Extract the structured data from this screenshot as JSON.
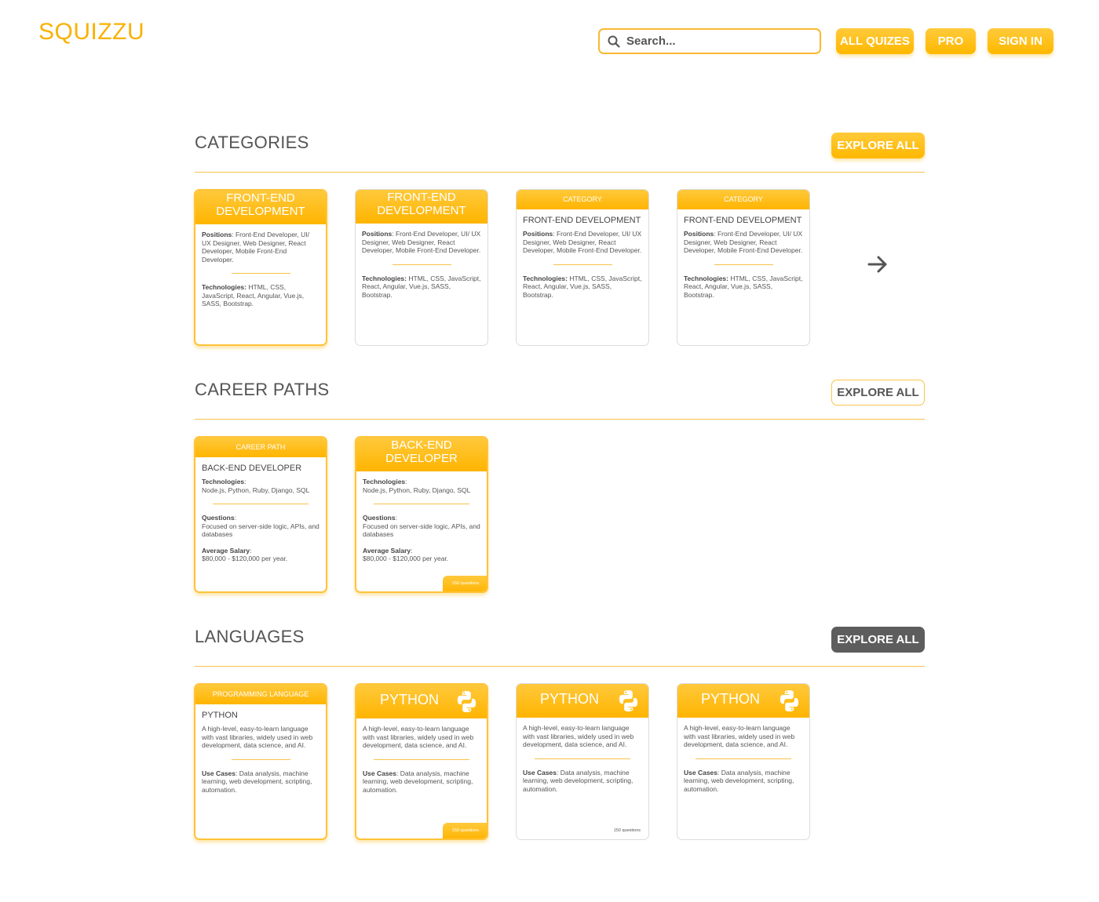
{
  "header": {
    "logo": "SQUIZZU",
    "search_placeholder": "Search...",
    "nav": [
      "ALL QUIZES",
      "PRO",
      "SIGN IN"
    ]
  },
  "sections": {
    "categories": {
      "title": "CATEGORIES",
      "explore": "EXPLORE ALL",
      "cards": [
        {
          "header": "FRONT-END DEVELOPMENT",
          "label1": "Positions",
          "text1": ": Front-End Developer, UI/ UX Designer, Web Designer, React Developer, Mobile Front-End Developer.",
          "label2": "Technologies:",
          "text2": " HTML, CSS, JavaScript, React, Angular, Vue.js, SASS, Bootstrap."
        },
        {
          "header": "FRONT-END DEVELOPMENT",
          "label1": "Positions",
          "text1": ": Front-End Developer, UI/ UX Designer, Web Designer, React Developer, Mobile Front-End Developer.",
          "label2": "Technologies:",
          "text2": " HTML, CSS, JavaScript, React, Angular, Vue.js, SASS, Bootstrap."
        },
        {
          "header": "CATEGORY",
          "title": "FRONT-END DEVELOPMENT",
          "label1": "Positions",
          "text1": ": Front-End Developer, UI/ UX Designer, Web Designer, React Developer, Mobile Front-End Developer.",
          "label2": "Technologies:",
          "text2": " HTML, CSS, JavaScript, React, Angular, Vue.js, SASS, Bootstrap."
        },
        {
          "header": "CATEGORY",
          "title": "FRONT-END DEVELOPMENT",
          "label1": "Positions",
          "text1": ": Front-End Developer, UI/ UX Designer, Web Designer, React Developer, Mobile Front-End Developer.",
          "label2": "Technologies:",
          "text2": " HTML, CSS, JavaScript, React, Angular, Vue.js, SASS, Bootstrap."
        }
      ]
    },
    "career_paths": {
      "title": "CAREER PATHS",
      "explore": "EXPLORE ALL",
      "cards": [
        {
          "header": "CAREER PATH",
          "title": "BACK-END DEVELOPER",
          "label1": "Technologies",
          "text1": "Node.js, Python, Ruby, Django, SQL",
          "label2": "Questions",
          "text2": "Focused on server-side logic, APIs, and databases",
          "label3": "Average Salary",
          "text3": "$80,000 - $120,000 per year."
        },
        {
          "header": "BACK-END DEVELOPER",
          "label1": "Technologies",
          "text1": "Node.js, Python, Ruby, Django, SQL",
          "label2": "Questions",
          "text2": "Focused on server-side logic, APIs, and databases",
          "label3": "Average Salary",
          "text3": "$80,000 - $120,000 per year.",
          "badge": "150 questions"
        }
      ]
    },
    "languages": {
      "title": "LANGUAGES",
      "explore": "EXPLORE ALL",
      "cards": [
        {
          "header": "PROGRAMMING LANGUAGE",
          "title": "PYTHON",
          "text1": "A high-level, easy-to-learn language with vast libraries, widely used in web development, data science, and AI.",
          "label2": "Use Cases",
          "text2": ": Data analysis, machine learning, web development, scripting, automation."
        },
        {
          "header": "PYTHON",
          "text1": "A high-level, easy-to-learn language with vast libraries, widely used in web development, data science, and AI.",
          "label2": "Use Cases",
          "text2": ": Data analysis, machine learning, web development, scripting, automation.",
          "badge": "150 questions"
        },
        {
          "header": "PYTHON",
          "text1": "A high-level, easy-to-learn language with vast libraries, widely used in web development, data science, and AI.",
          "label2": "Use Cases",
          "text2": ": Data analysis, machine learning, web development, scripting, automation.",
          "badge": "150 questions"
        },
        {
          "header": "PYTHON",
          "text1": "A high-level, easy-to-learn language with vast libraries, widely used in web development, data science, and AI.",
          "label2": "Use Cases",
          "text2": ": Data analysis, machine learning, web development, scripting, automation."
        }
      ]
    }
  },
  "colors": {
    "accent": "#ffb800",
    "accent_light": "#ffca3a",
    "dark_button": "#5d5d5d",
    "text": "#555555"
  },
  "icons": [
    "search-icon",
    "arrow-right-icon",
    "python-icon"
  ]
}
